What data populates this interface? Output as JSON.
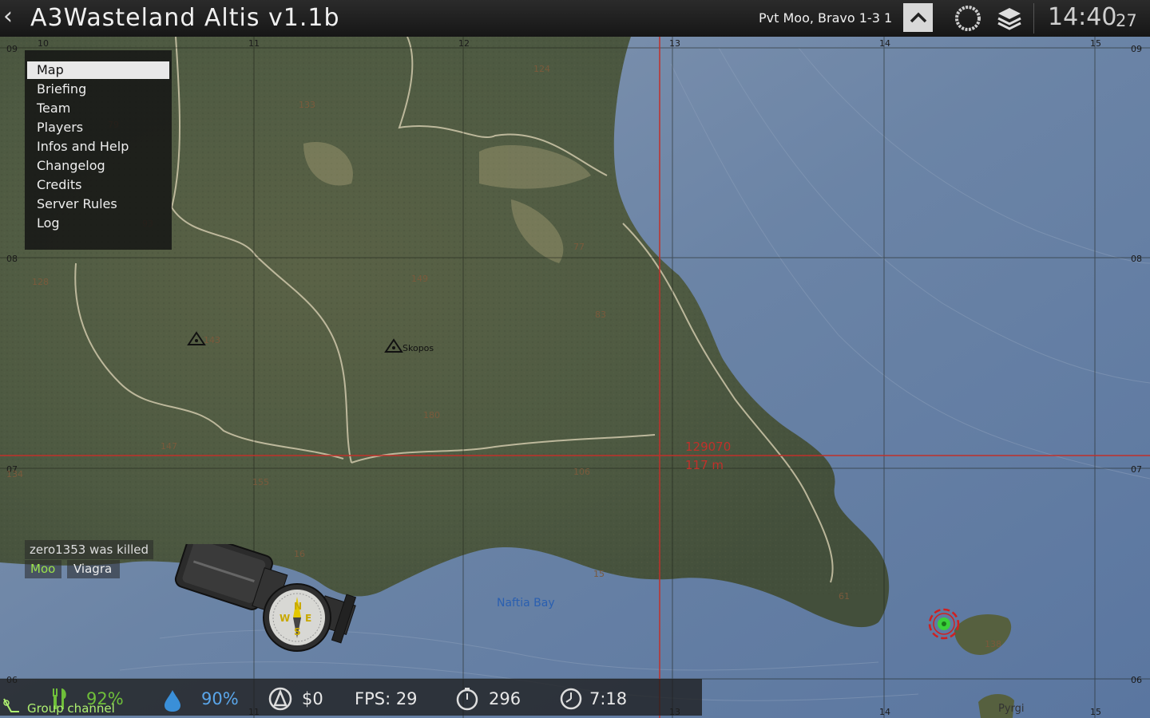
{
  "header": {
    "title": "A3Wasteland  Altis  v1.1b",
    "player": "Pvt Moo, Bravo 1-3 1",
    "time": "14:40",
    "seconds": "27"
  },
  "menu": {
    "items": [
      {
        "label": "Map",
        "selected": true
      },
      {
        "label": "Briefing",
        "selected": false
      },
      {
        "label": "Team",
        "selected": false
      },
      {
        "label": "Players",
        "selected": false
      },
      {
        "label": "Infos and Help",
        "selected": false
      },
      {
        "label": "Changelog",
        "selected": false
      },
      {
        "label": "Credits",
        "selected": false
      },
      {
        "label": "Server Rules",
        "selected": false
      },
      {
        "label": "Log",
        "selected": false
      }
    ]
  },
  "killfeed": {
    "message": "zero1353 was killed",
    "killer": "Moo",
    "victim": "Viagra"
  },
  "map": {
    "grid_top": [
      "10",
      "11",
      "12",
      "13",
      "14",
      "15"
    ],
    "grid_bottom": [
      "11",
      "13",
      "14",
      "15"
    ],
    "grid_left": [
      "09",
      "08",
      "07",
      "06"
    ],
    "grid_right": [
      "09",
      "08",
      "07",
      "06"
    ],
    "locations": [
      "Skopos",
      "Naftia Bay",
      "Pyrgi"
    ],
    "cursor_grid": "129070",
    "cursor_distance": "117 m",
    "elevations": [
      "124",
      "133",
      "79",
      "128",
      "93",
      "143",
      "155",
      "147",
      "134",
      "149",
      "180",
      "77",
      "83",
      "106",
      "16",
      "15",
      "61",
      "138"
    ]
  },
  "hud": {
    "food": "92%",
    "water": "90%",
    "money": "$0",
    "fps": "FPS: 29",
    "kills": "296",
    "playtime": "7:18",
    "channel": "Group channel"
  },
  "compass": {
    "n": "N",
    "s": "S",
    "e": "E",
    "w": "W"
  },
  "colors": {
    "accent_green": "#9be34a",
    "cursor_red": "#c0302a",
    "sea": "#6f86a6"
  },
  "icons": [
    "chevron-left-icon",
    "chevron-up-icon",
    "ring-icon",
    "layers-icon",
    "food-icon",
    "water-drop-icon",
    "money-icon",
    "stopwatch-icon",
    "clock-icon",
    "radio-icon",
    "compass-icon",
    "player-marker-icon",
    "mount-icon"
  ]
}
